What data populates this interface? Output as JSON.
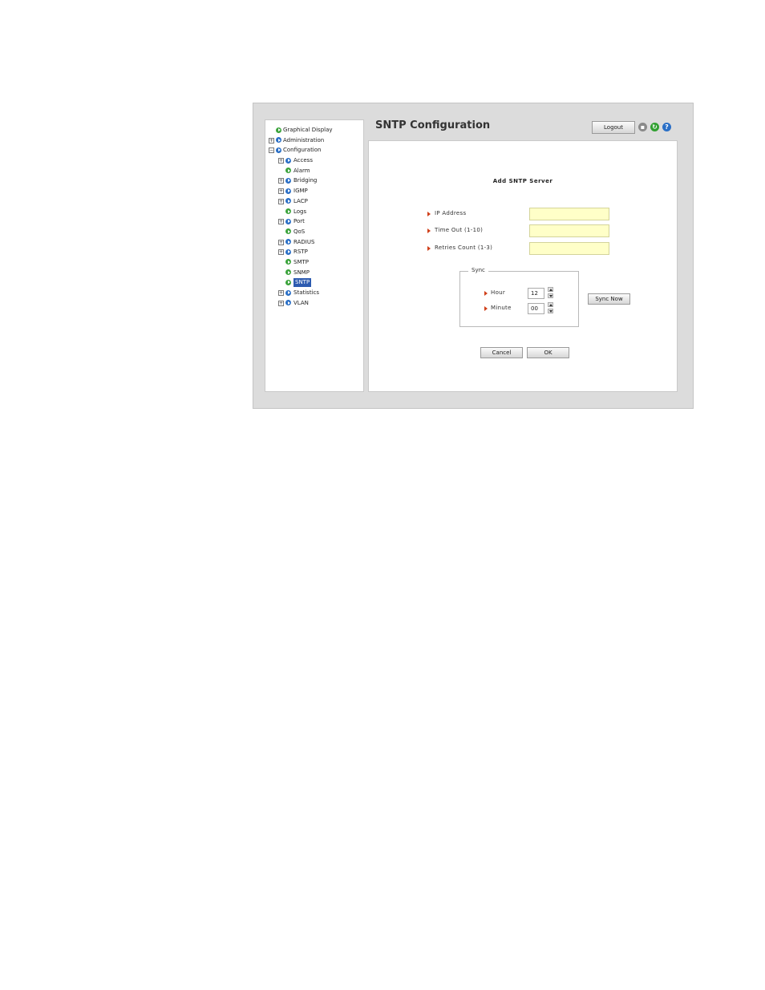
{
  "page_title": "SNTP Configuration",
  "header": {
    "logout_label": "Logout",
    "icons": [
      "print-icon",
      "refresh-icon",
      "help-icon"
    ]
  },
  "nav": {
    "items": [
      {
        "label": "Graphical Display",
        "expander": "",
        "icon": "green"
      },
      {
        "label": "Administration",
        "expander": "+",
        "icon": "blue"
      },
      {
        "label": "Configuration",
        "expander": "−",
        "icon": "blue"
      },
      {
        "label": "Access",
        "expander": "+",
        "icon": "blue"
      },
      {
        "label": "Alarm",
        "expander": "",
        "icon": "green"
      },
      {
        "label": "Bridging",
        "expander": "+",
        "icon": "blue"
      },
      {
        "label": "IGMP",
        "expander": "+",
        "icon": "blue"
      },
      {
        "label": "LACP",
        "expander": "+",
        "icon": "blue"
      },
      {
        "label": "Logs",
        "expander": "",
        "icon": "green"
      },
      {
        "label": "Port",
        "expander": "+",
        "icon": "blue"
      },
      {
        "label": "QoS",
        "expander": "",
        "icon": "green"
      },
      {
        "label": "RADIUS",
        "expander": "+",
        "icon": "blue"
      },
      {
        "label": "RSTP",
        "expander": "+",
        "icon": "blue"
      },
      {
        "label": "SMTP",
        "expander": "",
        "icon": "green"
      },
      {
        "label": "SNMP",
        "expander": "",
        "icon": "green"
      },
      {
        "label": "SNTP",
        "expander": "",
        "icon": "green",
        "selected": true
      },
      {
        "label": "Statistics",
        "expander": "+",
        "icon": "blue"
      },
      {
        "label": "VLAN",
        "expander": "+",
        "icon": "blue"
      }
    ]
  },
  "form": {
    "title": "Add SNTP Server",
    "fields": [
      {
        "label": "IP Address",
        "value": ""
      },
      {
        "label": "Time Out (1-10)",
        "value": ""
      },
      {
        "label": "Retries Count (1-3)",
        "value": ""
      }
    ],
    "sync": {
      "legend": "Sync",
      "hour_label": "Hour",
      "hour_value": "12",
      "minute_label": "Minute",
      "minute_value": "00",
      "sync_now_label": "Sync Now"
    },
    "cancel_label": "Cancel",
    "ok_label": "OK"
  },
  "colors": {
    "selected_nav_bg": "#2d5bb0",
    "input_bg": "#ffffc8",
    "label_arrow": "#d0401a"
  }
}
